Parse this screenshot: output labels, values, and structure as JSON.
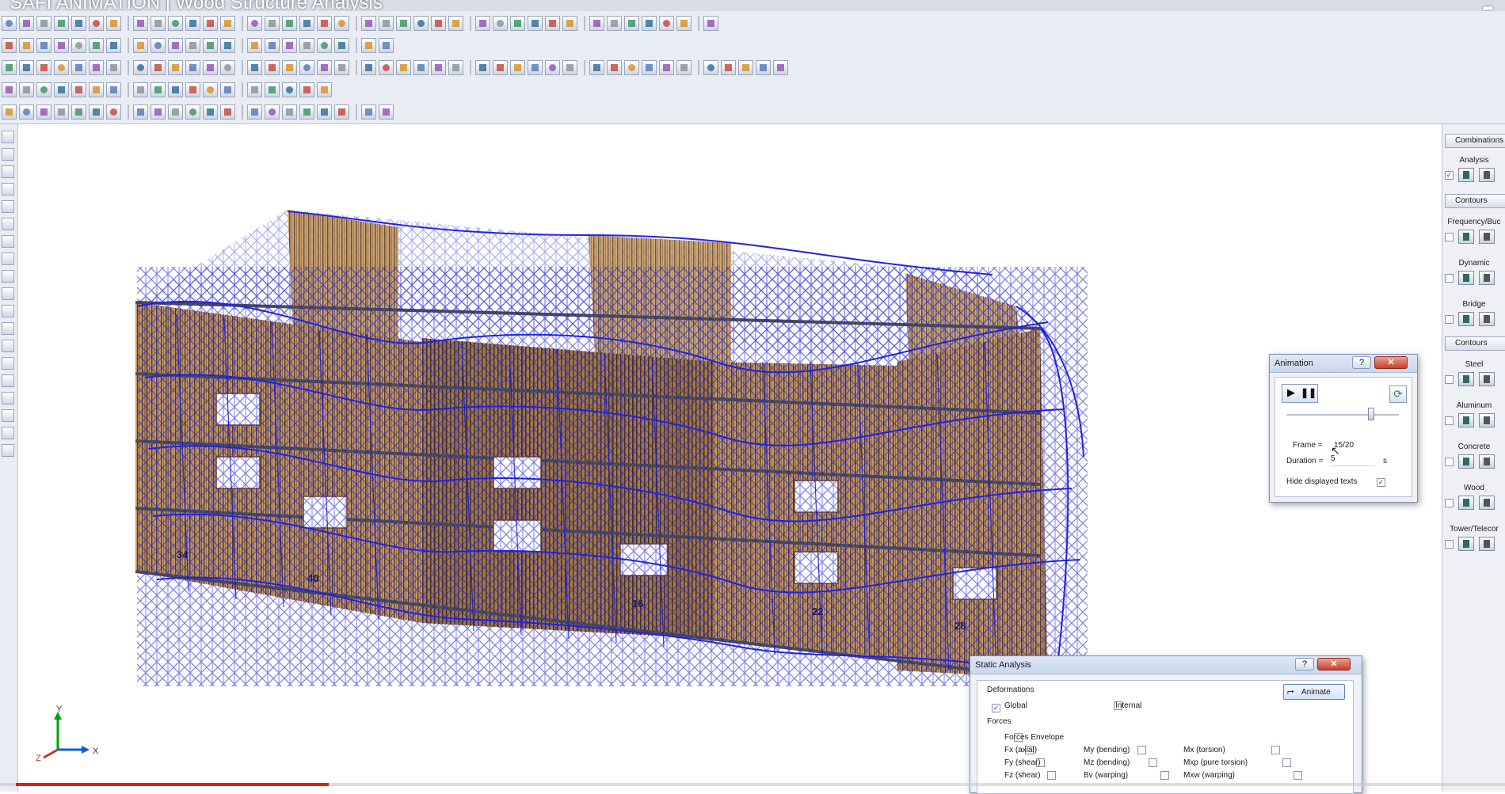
{
  "window": {
    "title": "SAFI ANIMATION | Wood Structure Analysis",
    "share_icon": "share-arrow-icon"
  },
  "toolbar_icons": {
    "row_count": 5,
    "names": [
      "new-file-icon",
      "open-icon",
      "save-icon",
      "print-icon",
      "undo-icon",
      "redo-icon",
      "select-icon",
      "zoom-icon",
      "node-icon",
      "member-icon",
      "load-icon",
      "analysis-icon"
    ]
  },
  "left_tools": {
    "icons": [
      "pan-hand-icon",
      "rotate-globe-icon",
      "grid-icon",
      "orbit-icon",
      "zoom-window-icon",
      "zoom-extents-icon",
      "view-3d-icon",
      "view-front-icon",
      "view-back-icon",
      "view-left-icon",
      "view-right-icon",
      "view-top-icon",
      "view-bottom-icon",
      "mesh-icon",
      "display-options-icon",
      "render-icon",
      "color-icon",
      "active-tool-icon",
      "shading-icon"
    ]
  },
  "right_panel": {
    "combinations": "Combinations",
    "analysis": "Analysis",
    "contours_1": "Contours",
    "frequency": "Frequency/Buc",
    "dynamic": "Dynamic",
    "bridge": "Bridge",
    "contours_2": "Contours",
    "steel": "Steel",
    "aluminum": "Aluminum",
    "concrete": "Concrete",
    "wood": "Wood",
    "tower": "Tower/Telecor",
    "analysis_checked": "✓"
  },
  "viewport": {
    "node_labels": [
      "34",
      "40",
      "16",
      "22",
      "28"
    ],
    "axis": {
      "x": "X",
      "y": "Y",
      "z": "Z"
    },
    "colors": {
      "frame": "#1c1ed6",
      "wall": "#b98a52",
      "wall_dark": "#5a3d1f",
      "deformed": "#2222e8"
    }
  },
  "animation_dialog": {
    "title": "Animation",
    "help": "?",
    "close": "✕",
    "frame_label": "Frame =",
    "frame_value": "15/20",
    "frame_fraction": 0.75,
    "duration_label": "Duration =",
    "duration_value": "5",
    "duration_unit": "s",
    "hide_texts_label": "Hide displayed texts",
    "hide_texts_checked": "✓",
    "play_icon": "play-icon",
    "pause_icon": "pause-icon",
    "refresh_icon": "loop-icon"
  },
  "static_dialog": {
    "title": "Static Analysis",
    "help": "?",
    "close": "✕",
    "deformations_label": "Deformations",
    "global_label": "Global",
    "global_checked": "✓",
    "internal_label": "Internal",
    "animate_label": "Animate",
    "forces_label": "Forces",
    "forces_envelope": "Forces Envelope",
    "fx": "Fx (axial)",
    "fy": "Fy (shear)",
    "fz": "Fz (shear)",
    "my": "My (bending)",
    "mz": "Mz (bending)",
    "bv": "Bv (warping)",
    "mx": "Mx (torsion)",
    "mxp": "Mxp (pure torsion)",
    "mxw": "Mxw (warping)"
  },
  "video_progress": {
    "fraction": 0.21,
    "color": "#e41b13"
  }
}
